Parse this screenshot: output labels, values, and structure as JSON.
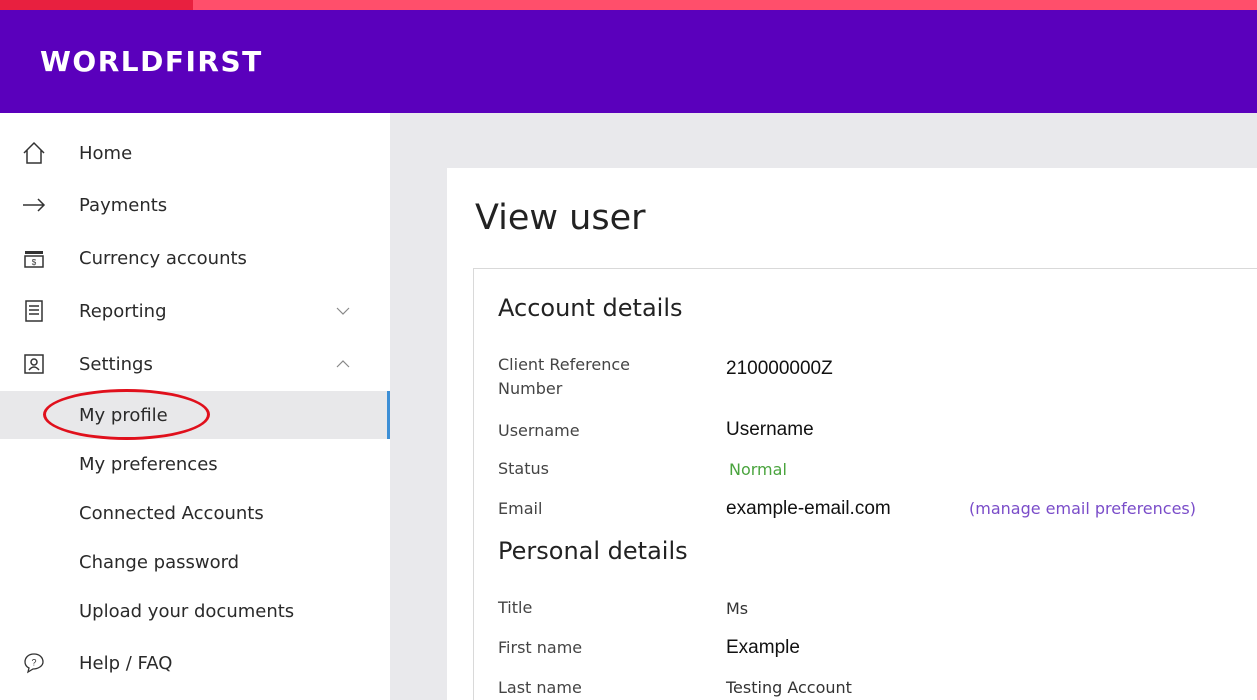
{
  "brand": {
    "name": "WORLDFIRST"
  },
  "sidebar": {
    "items": [
      {
        "label": "Home",
        "icon": "home-icon"
      },
      {
        "label": "Payments",
        "icon": "arrow-right-icon"
      },
      {
        "label": "Currency accounts",
        "icon": "wallet-icon"
      },
      {
        "label": "Reporting",
        "icon": "document-icon",
        "chevron": "chevron-down-icon"
      },
      {
        "label": "Settings",
        "icon": "id-card-icon",
        "chevron": "chevron-up-icon"
      }
    ],
    "settings_sub": [
      {
        "label": "My profile",
        "active": true
      },
      {
        "label": "My preferences"
      },
      {
        "label": "Connected Accounts"
      },
      {
        "label": "Change password"
      },
      {
        "label": "Upload your documents"
      }
    ],
    "help": {
      "label": "Help / FAQ",
      "icon": "help-icon"
    }
  },
  "main": {
    "title": "View user",
    "account_details": {
      "title": "Account details",
      "client_reference_label": "Client Reference Number",
      "client_reference_value": "210000000Z",
      "username_label": "Username",
      "username_value": "Username",
      "status_label": "Status",
      "status_value": "Normal",
      "email_label": "Email",
      "email_value": "example-email.com",
      "manage_link": "(manage email preferences)"
    },
    "personal_details": {
      "title": "Personal details",
      "title_label": "Title",
      "title_value": "Ms",
      "first_name_label": "First name",
      "first_name_value": "Example",
      "last_name_label": "Last name",
      "last_name_value": "Testing Account"
    }
  },
  "colors": {
    "header_bg": "#5a00bc",
    "top_strip": "#ff4f6b",
    "status_green": "#4aa43e",
    "link_purple": "#7a4cc9",
    "annotation_red": "#e0101c",
    "active_indicator": "#3d8fd6"
  }
}
